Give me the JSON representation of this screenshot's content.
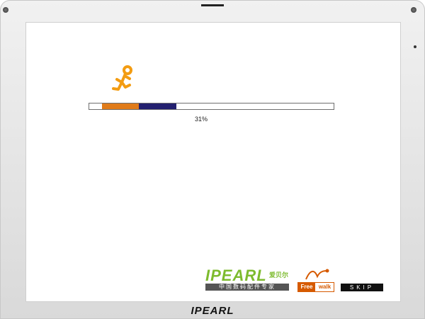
{
  "progress": {
    "value_percent": 31,
    "label": "31%"
  },
  "branding": {
    "ipearl_word": "IPEARL",
    "ipearl_cn": "爱贝尔",
    "ipearl_tagline": "中国数码配件专家",
    "freewalk_free": "Free",
    "freewalk_walk": "walk",
    "bottom_logo": "IPEARL"
  },
  "skip_label": "SKIP",
  "colors": {
    "runner": "#f39c12",
    "progress_orange": "#e07b1a",
    "progress_navy": "#23206f",
    "brand_green": "#7dbb2e"
  },
  "icons": {
    "runner": "running-person-icon"
  }
}
